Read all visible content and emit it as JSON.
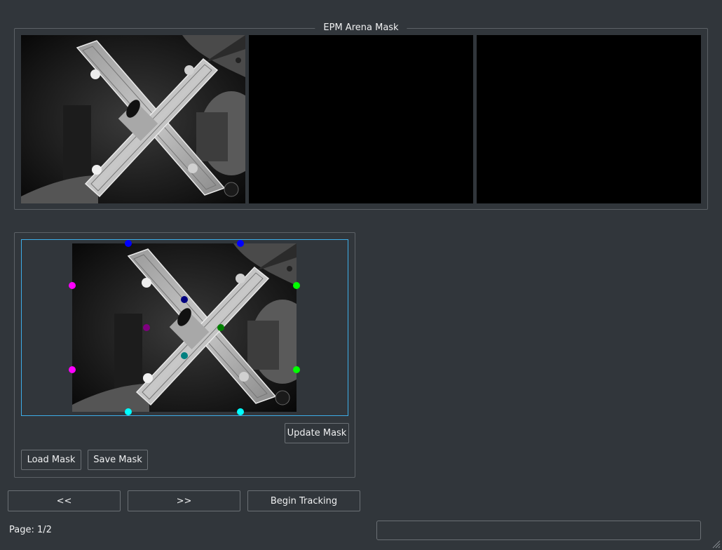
{
  "arena_group": {
    "title": "EPM Arena Mask",
    "previews": [
      "arena-frame",
      "empty",
      "empty"
    ]
  },
  "editor": {
    "update_mask_label": "Update Mask",
    "load_mask_label": "Load Mask",
    "save_mask_label": "Save Mask",
    "handle_colors": {
      "top": "#0000ff",
      "left": "#ff00ff",
      "right": "#00ff00",
      "bottom": "#00ffff",
      "inner_top": "#000080",
      "inner_left": "#800080",
      "inner_right": "#008000",
      "inner_bottom": "#008080"
    }
  },
  "nav": {
    "prev_label": "<<",
    "next_label": ">>",
    "begin_label": "Begin Tracking"
  },
  "status": {
    "page_text": "Page: 1/2",
    "message": ""
  },
  "colors": {
    "background": "#31363b",
    "accent": "#3daee9"
  }
}
